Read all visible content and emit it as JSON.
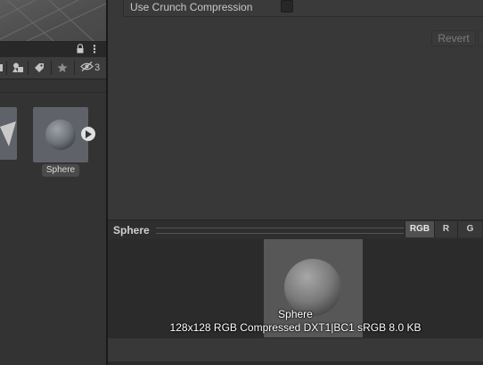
{
  "inspector": {
    "crunch_label": "Use Crunch Compression",
    "crunch_checked": false,
    "revert_label": "Revert"
  },
  "project": {
    "hidden_count": "3",
    "asset": {
      "name": "Sphere"
    }
  },
  "preview": {
    "title": "Sphere",
    "channels": [
      "RGB",
      "R",
      "G"
    ],
    "active_channel": "RGB",
    "image_name": "Sphere",
    "info": "128x128  RGB Compressed DXT1|BC1 sRGB  8.0 KB"
  },
  "icons": {
    "lock": "lock-icon",
    "kebab": "kebab-menu-icon",
    "scene": "scene-icon",
    "filter_type": "shapes-icon",
    "label": "tag-icon",
    "favorite": "star-icon",
    "hidden": "eye-slash-icon",
    "play": "play-icon"
  },
  "colors": {
    "panel_bg": "#383838",
    "dark_bg": "#2b2b2b",
    "text": "#c8c8c8",
    "active_channel_bg": "#505050"
  }
}
